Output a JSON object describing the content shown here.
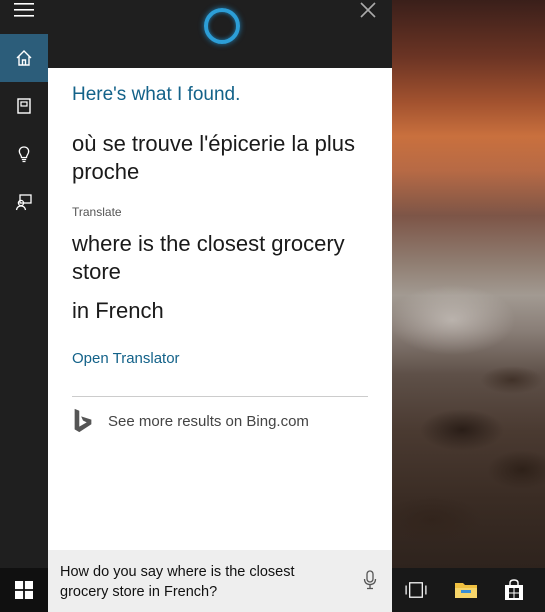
{
  "cortana": {
    "found_heading": "Here's what I found.",
    "source_text": "où se trouve l'épicerie la plus proche",
    "translate_label": "Translate",
    "translated_text": "where is the closest grocery store",
    "language": "in French",
    "open_translator": "Open Translator",
    "bing_link": "See more results on Bing.com"
  },
  "query": {
    "text": "How do you say where is the closest grocery store in French?"
  },
  "rail": {
    "items": [
      {
        "icon": "hamburger-menu-icon"
      },
      {
        "icon": "home-icon",
        "active": true
      },
      {
        "icon": "notebook-icon"
      },
      {
        "icon": "lightbulb-icon"
      },
      {
        "icon": "feedback-icon"
      }
    ]
  },
  "taskbar": {
    "icons": [
      "windows-start-icon",
      "task-view-icon",
      "file-explorer-icon",
      "store-icon"
    ]
  },
  "colors": {
    "accent": "#2c5d7a",
    "link": "#136289",
    "cortana_ring": "#2c9ed7"
  }
}
